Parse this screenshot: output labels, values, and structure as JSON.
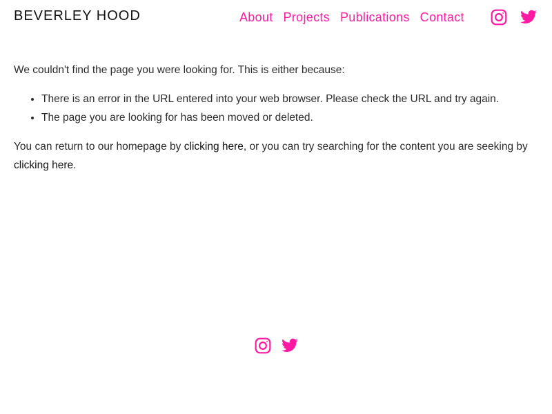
{
  "header": {
    "site_title": "BEVERLEY HOOD",
    "nav": [
      {
        "label": "About"
      },
      {
        "label": "Projects"
      },
      {
        "label": "Publications"
      },
      {
        "label": "Contact"
      }
    ],
    "social_icons": [
      "instagram-icon",
      "twitter-icon"
    ]
  },
  "main": {
    "intro": "We couldn't find the page you were looking for. This is either because:",
    "reasons": [
      "There is an error in the URL entered into your web browser. Please check the URL and try again.",
      "The page you are looking for has been moved or deleted."
    ],
    "return_text_1": "You can return to our homepage by ",
    "return_link_1": "clicking here",
    "return_text_2": ", or you can try searching for the content you are seeking by ",
    "return_link_2": "clicking here",
    "return_text_3": "."
  },
  "footer": {
    "social_icons": [
      "instagram-icon",
      "twitter-icon"
    ]
  },
  "colors": {
    "accent": "#ff1aa3",
    "text": "#2b2b2b",
    "title": "#111111",
    "background": "#ffffff"
  }
}
